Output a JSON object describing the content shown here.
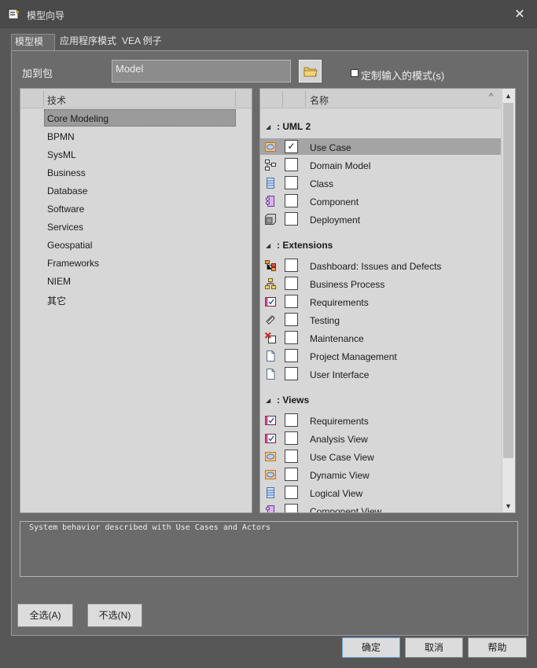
{
  "window": {
    "title": "模型向导",
    "close_glyph": "✕",
    "icon": "wizard-icon"
  },
  "tabs": [
    {
      "label": "模型模式",
      "active": true
    },
    {
      "label": "应用程序模式",
      "active": false
    },
    {
      "label": "VEA 例子",
      "active": false
    }
  ],
  "package": {
    "label": "加到包",
    "value": "Model",
    "browse_icon": "folder-icon"
  },
  "custom_pattern": {
    "label": "定制输入的模式(s)",
    "checked": false
  },
  "technology": {
    "header": "技术",
    "items": [
      "Core Modeling",
      "BPMN",
      "SysML",
      "Business",
      "Database",
      "Software",
      "Services",
      "Geospatial",
      "Frameworks",
      "NIEM",
      "其它"
    ],
    "selected_index": 0
  },
  "types": {
    "header": "名称",
    "sort_glyph": "^",
    "scroll_up": "▲",
    "scroll_down": "▼",
    "groups": [
      {
        "label": ": UML 2",
        "collapse_glyph": "◢",
        "items": [
          {
            "label": "Use Case",
            "checked": true,
            "icon": "use-case-icon",
            "selected": true
          },
          {
            "label": "Domain Model",
            "checked": false,
            "icon": "domain-model-icon"
          },
          {
            "label": "Class",
            "checked": false,
            "icon": "class-icon"
          },
          {
            "label": "Component",
            "checked": false,
            "icon": "component-icon"
          },
          {
            "label": "Deployment",
            "checked": false,
            "icon": "deployment-icon"
          }
        ]
      },
      {
        "label": ": Extensions",
        "collapse_glyph": "◢",
        "items": [
          {
            "label": "Dashboard: Issues and Defects",
            "checked": false,
            "icon": "dashboard-icon"
          },
          {
            "label": "Business Process",
            "checked": false,
            "icon": "business-process-icon"
          },
          {
            "label": "Requirements",
            "checked": false,
            "icon": "requirements-icon"
          },
          {
            "label": "Testing",
            "checked": false,
            "icon": "testing-icon"
          },
          {
            "label": "Maintenance",
            "checked": false,
            "icon": "maintenance-icon"
          },
          {
            "label": "Project Management",
            "checked": false,
            "icon": "document-icon"
          },
          {
            "label": "User Interface",
            "checked": false,
            "icon": "document-icon"
          }
        ]
      },
      {
        "label": ": Views",
        "collapse_glyph": "◢",
        "items": [
          {
            "label": "Requirements",
            "checked": false,
            "icon": "requirements-icon"
          },
          {
            "label": "Analysis View",
            "checked": false,
            "icon": "requirements-icon"
          },
          {
            "label": "Use Case View",
            "checked": false,
            "icon": "use-case-icon"
          },
          {
            "label": "Dynamic View",
            "checked": false,
            "icon": "use-case-icon"
          },
          {
            "label": "Logical View",
            "checked": false,
            "icon": "class-icon"
          },
          {
            "label": "Component View",
            "checked": false,
            "icon": "component-icon"
          }
        ]
      }
    ]
  },
  "description": "System behavior described with Use Cases and Actors",
  "buttons": {
    "select_all": "全选(A)",
    "select_none": "不选(N)",
    "ok": "确定",
    "cancel": "取消",
    "help": "帮助"
  }
}
